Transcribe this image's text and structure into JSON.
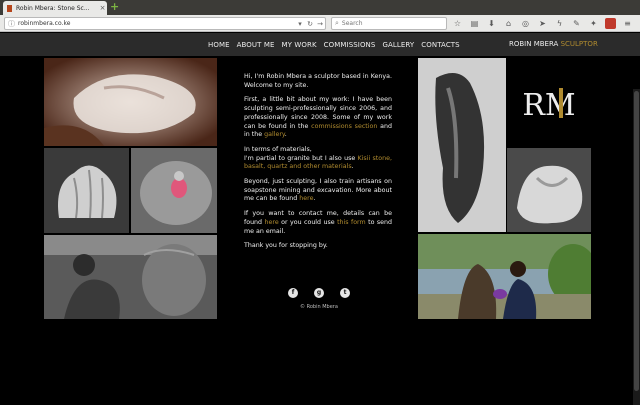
{
  "browser": {
    "tab_title": "Robin Mbera: Stone Sc...",
    "tab_close": "×",
    "new_tab": "+",
    "url": "robinmbera.co.ke",
    "search_placeholder": "Search",
    "colors": {
      "chrome": "#3c3b37",
      "toolbar": "#e9e9e7"
    },
    "toolbar_icons": [
      "bookmark-star-icon",
      "reading-list-icon",
      "download-icon",
      "home-icon",
      "pocket-icon",
      "send-icon",
      "flash-icon",
      "brush-icon",
      "wrench-icon",
      "addon-icon",
      "menu-icon"
    ]
  },
  "site": {
    "nav": [
      "HOME",
      "ABOUT ME",
      "MY WORK",
      "COMMISSIONS",
      "GALLERY",
      "CONTACTS"
    ],
    "brand_first": "ROBIN MBERA",
    "brand_second": "SCULPTOR",
    "brand_color": "#b08b2f",
    "logo_text": "RM",
    "intro": {
      "greeting": "Hi, I'm Robin Mbera a sculptor based in Kenya. Welcome to my site.",
      "p1": "First, a little bit about my work: I have been sculpting semi-professionally since 2006, and professionally since 2008.",
      "p1b_pre": "Some of my work can be found in the",
      "p1b_link1": "commissions section",
      "p1b_mid": "and in the",
      "p1b_link2": "gallery",
      "p1b_end": ".",
      "p2_lead": "In terms of materials,",
      "p2_pre": "I'm partial to granite but I also use",
      "p2_link": "Kisii stone, basalt, quartz and other materials",
      "p2_end": ".",
      "p3_pre": "Beyond, just sculpting, I also train artisans on soapstone mining and excavation. More about me can be found",
      "p3_link": "here",
      "p3_end": ".",
      "p4_pre": "If you want to contact me, details can be found",
      "p4_link1": "here",
      "p4_mid": "or you could use",
      "p4_link2": "this form",
      "p4_end": "to send me an email.",
      "p5": "Thank you for stopping by."
    },
    "social": [
      "f",
      "g",
      "t"
    ],
    "copyright": "© Robin Mbera"
  }
}
